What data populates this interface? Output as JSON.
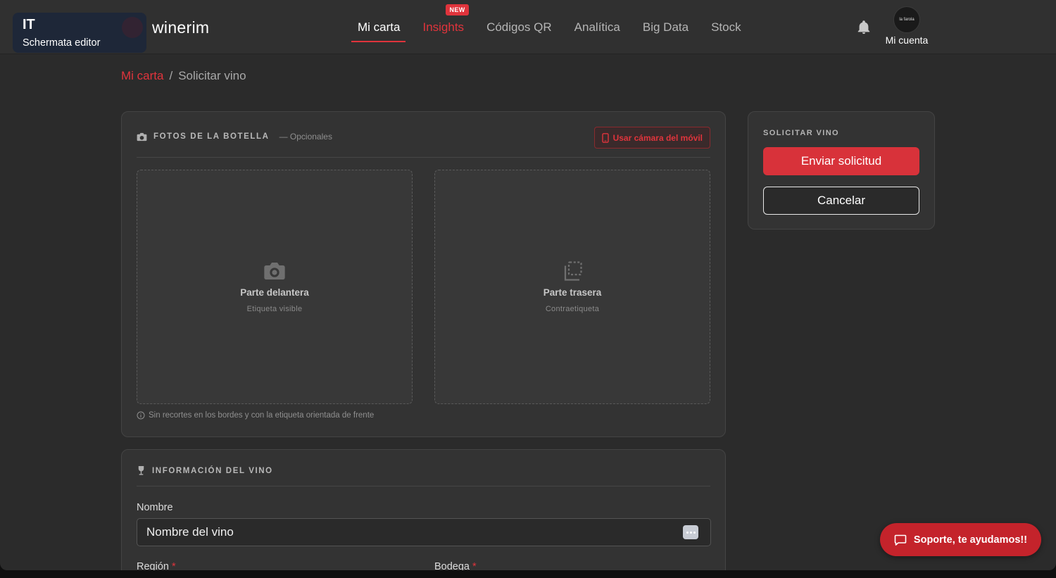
{
  "lang_badge": {
    "code": "IT",
    "label": "Schermata editor"
  },
  "brand": "winerim",
  "nav": [
    {
      "label": "Mi carta"
    },
    {
      "label": "Insights",
      "badge": "NEW"
    },
    {
      "label": "Códigos QR"
    },
    {
      "label": "Analítica"
    },
    {
      "label": "Big Data"
    },
    {
      "label": "Stock"
    }
  ],
  "account": {
    "label": "Mi cuenta",
    "avatar_text": "la farola"
  },
  "breadcrumb": {
    "root": "Mi carta",
    "separator": "/",
    "current": "Solicitar vino"
  },
  "photos": {
    "title": "FOTOS DE LA BOTELLA",
    "optional": "— Opcionales",
    "camera_button": "Usar cámara del móvil",
    "front": {
      "title": "Parte delantera",
      "subtitle": "Etiqueta visible"
    },
    "back": {
      "title": "Parte trasera",
      "subtitle": "Contraetiqueta"
    },
    "hint": "Sin recortes en los bordes y con la etiqueta orientada de frente"
  },
  "info": {
    "title": "INFORMACIÓN DEL VINO",
    "name_label": "Nombre",
    "name_placeholder": "Nombre del vino",
    "region_label": "Región",
    "winery_label": "Bodega",
    "required_mark": "*"
  },
  "side": {
    "title": "SOLICITAR VINO",
    "submit": "Enviar solicitud",
    "cancel": "Cancelar"
  },
  "support": "Soporte, te ayudamos!!",
  "colors": {
    "accent": "#e0343c",
    "background": "#2b2b2b",
    "card": "#333333"
  }
}
